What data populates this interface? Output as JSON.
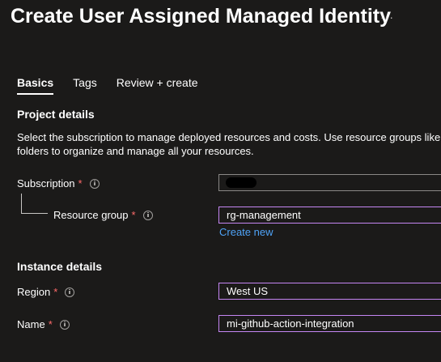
{
  "header": {
    "title": "Create User Assigned Managed Identity",
    "more_label": "···"
  },
  "tabs": [
    {
      "label": "Basics",
      "active": true
    },
    {
      "label": "Tags",
      "active": false
    },
    {
      "label": "Review + create",
      "active": false
    }
  ],
  "project_details": {
    "title": "Project details",
    "description": "Select the subscription to manage deployed resources and costs. Use resource groups like folders to organize and manage all your resources.",
    "subscription": {
      "label": "Subscription",
      "required_mark": "*",
      "value_redacted": true
    },
    "resource_group": {
      "label": "Resource group",
      "required_mark": "*",
      "value": "rg-management",
      "create_new_label": "Create new"
    }
  },
  "instance_details": {
    "title": "Instance details",
    "region": {
      "label": "Region",
      "required_mark": "*",
      "value": "West US"
    },
    "name": {
      "label": "Name",
      "required_mark": "*",
      "value": "mi-github-action-integration"
    }
  },
  "colors": {
    "background": "#1b1a19",
    "focus_border": "#c586f3",
    "required": "#ff6b6b",
    "link": "#4fa3f7"
  },
  "icons": [
    "more-icon",
    "info-icon"
  ]
}
